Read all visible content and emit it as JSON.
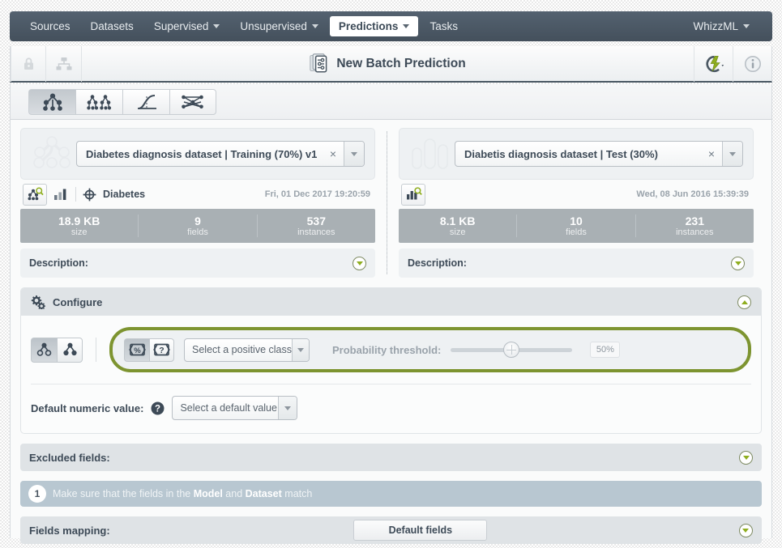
{
  "nav": {
    "items": [
      {
        "label": "Sources",
        "caret": false,
        "active": false
      },
      {
        "label": "Datasets",
        "caret": false,
        "active": false
      },
      {
        "label": "Supervised",
        "caret": true,
        "active": false
      },
      {
        "label": "Unsupervised",
        "caret": true,
        "active": false
      },
      {
        "label": "Predictions",
        "caret": true,
        "active": true
      },
      {
        "label": "Tasks",
        "caret": false,
        "active": false
      }
    ],
    "right": {
      "label": "WhizzML",
      "caret": true
    }
  },
  "header": {
    "title": "New Batch Prediction",
    "title_icon": "batch-prediction-icon",
    "lock_icon": "lock-icon",
    "share_icon": "share-network-icon",
    "actions_icon": "lightning-actions-icon",
    "info_icon": "info-icon"
  },
  "type_tabs": [
    {
      "name": "model-tab",
      "icon": "decision-tree-icon",
      "active": true
    },
    {
      "name": "ensemble-tab",
      "icon": "ensemble-icon",
      "active": false
    },
    {
      "name": "logistic-regression-tab",
      "icon": "logistic-curve-icon",
      "active": false
    },
    {
      "name": "deepnet-tab",
      "icon": "deepnet-icon",
      "active": false
    }
  ],
  "model_panel": {
    "watermark_icon": "decision-tree-watermark",
    "selected": "Diabetes diagnosis dataset | Training (70%) v1",
    "clear_label": "×",
    "objective_name": "Diabetes",
    "objective_icon": "target-icon",
    "preview_icon": "model-search-icon",
    "chart_icon": "bar-chart-icon",
    "date": "Fri, 01 Dec 2017 19:20:59",
    "stats": [
      {
        "value": "18.9 KB",
        "label": "size"
      },
      {
        "value": "9",
        "label": "fields"
      },
      {
        "value": "537",
        "label": "instances"
      }
    ],
    "description_label": "Description:"
  },
  "dataset_panel": {
    "watermark_icon": "bar-chart-watermark",
    "selected": "Diabetis diagnosis dataset | Test (30%)",
    "clear_label": "×",
    "preview_icon": "dataset-search-icon",
    "date": "Wed, 08 Jun 2016 15:39:39",
    "stats": [
      {
        "value": "8.1 KB",
        "label": "size"
      },
      {
        "value": "10",
        "label": "fields"
      },
      {
        "value": "231",
        "label": "instances"
      }
    ],
    "description_label": "Description:"
  },
  "configure": {
    "title": "Configure",
    "gear_icon": "gears-icon",
    "output_toggles": [
      {
        "name": "single-prediction-toggle",
        "icon": "single-node-icon",
        "active": true
      },
      {
        "name": "all-predictions-toggle",
        "icon": "filled-node-icon",
        "active": false
      }
    ],
    "operating_toggles": [
      {
        "name": "probability-toggle",
        "icon": "percent-brace-icon",
        "active": true
      },
      {
        "name": "confidence-toggle",
        "icon": "question-brace-icon",
        "active": false
      }
    ],
    "positive_class_placeholder": "Select a positive class",
    "threshold_label": "Probability threshold:",
    "threshold_value": "50%",
    "threshold_percent": 50,
    "default_numeric_label": "Default numeric value:",
    "help_icon": "help-question-icon",
    "default_value_placeholder": "Select a default value",
    "excluded_fields_label": "Excluded fields:",
    "notice": {
      "number": "1",
      "prefix": "Make sure that the fields in the ",
      "bold1": "Model",
      "middle": " and ",
      "bold2": "Dataset",
      "suffix": " match"
    },
    "fields_mapping_label": "Fields mapping:",
    "default_fields_button": "Default fields"
  },
  "colors": {
    "nav_bg": "#4b5863",
    "accent_green": "#7d9430",
    "chevron_green": "#8fae1f",
    "stats_bar": "#a9b0b4",
    "notice_bg": "#b8c7d1",
    "text_dark": "#3d4a57"
  }
}
